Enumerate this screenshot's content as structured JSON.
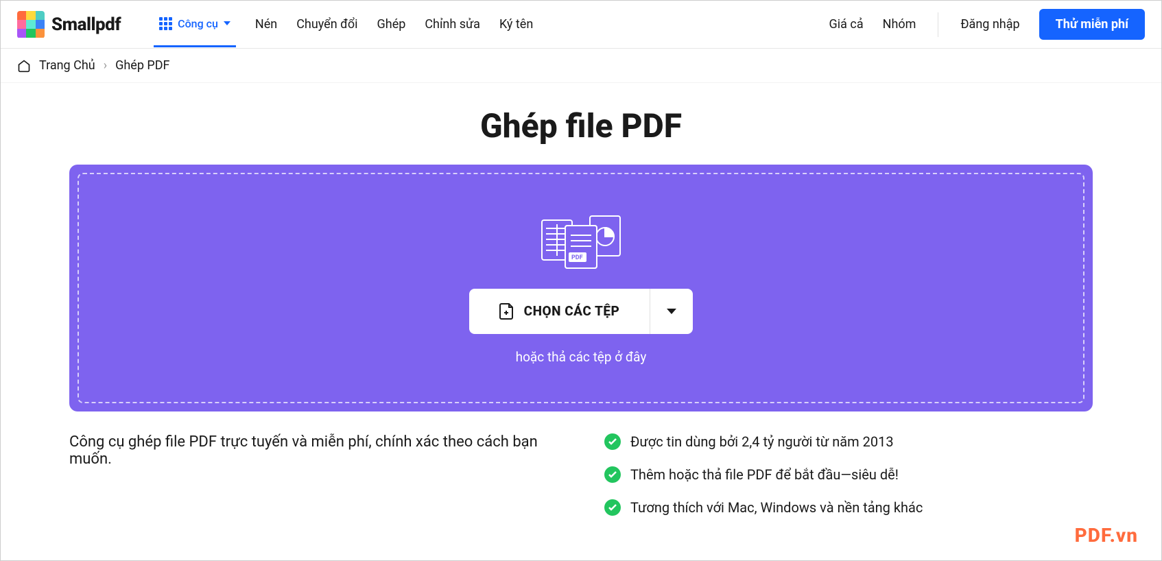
{
  "brand": "Smallpdf",
  "nav": {
    "tools": "Công cụ",
    "items": [
      "Nén",
      "Chuyển đổi",
      "Ghép",
      "Chỉnh sửa",
      "Ký tên"
    ],
    "pricing": "Giá cả",
    "teams": "Nhóm",
    "login": "Đăng nhập",
    "cta": "Thử miễn phí"
  },
  "breadcrumb": {
    "home": "Trang Chủ",
    "current": "Ghép PDF"
  },
  "title": "Ghép file PDF",
  "dropzone": {
    "choose": "CHỌN CÁC TỆP",
    "hint": "hoặc thả các tệp ở đây"
  },
  "tagline": "Công cụ ghép file PDF trực tuyến và miễn phí, chính xác theo cách bạn muốn.",
  "benefits": [
    "Được tin dùng bởi 2,4 tỷ người từ năm 2013",
    "Thêm hoặc thả file PDF để bắt đầu—siêu dễ!",
    "Tương thích với Mac, Windows và nền tảng khác"
  ],
  "logo_colors": [
    "#ff6b3d",
    "#ffd93d",
    "#4ecdc4",
    "#ff6b9d",
    "#5eead4",
    "#3b82f6",
    "#a855f7",
    "#22c55e",
    "#fb923c"
  ],
  "watermark": "PDF.vn"
}
